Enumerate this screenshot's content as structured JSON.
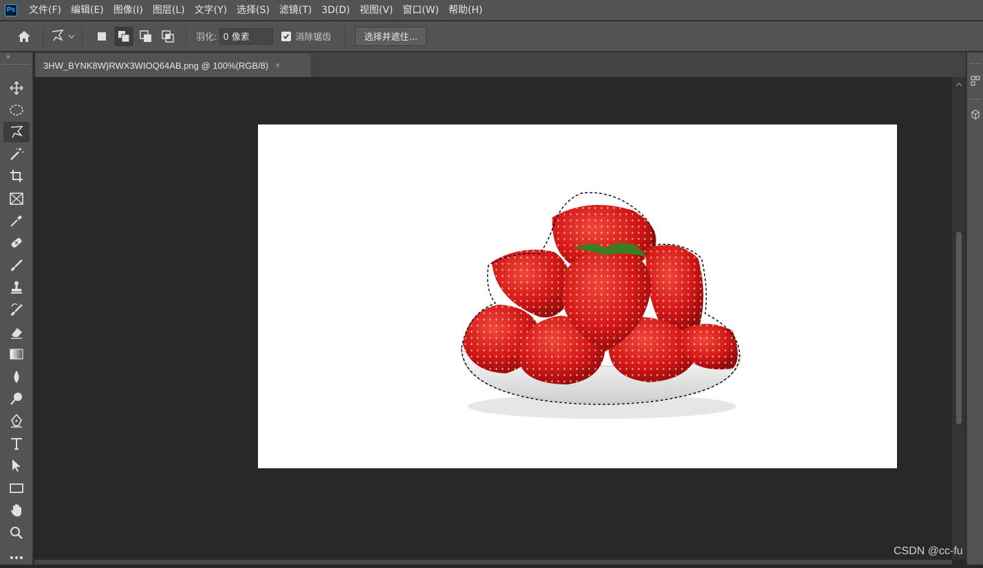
{
  "app": {
    "logo_text": "Ps",
    "accent": "#31a8ff"
  },
  "menu": [
    "文件(F)",
    "编辑(E)",
    "图像(I)",
    "图层(L)",
    "文字(Y)",
    "选择(S)",
    "滤镜(T)",
    "3D(D)",
    "视图(V)",
    "窗口(W)",
    "帮助(H)"
  ],
  "options": {
    "home_icon": "home-icon",
    "tool_preset_icon": "polygonal-lasso-icon",
    "feather_label": "羽化:",
    "feather_value": "0 像素",
    "antialias_label": "消除锯齿",
    "antialias_checked": true,
    "select_mask_label": "选择并遮住..."
  },
  "tools": [
    "move-icon",
    "ellipse-marquee-icon",
    "polygonal-lasso-icon",
    "magic-wand-icon",
    "crop-icon",
    "frame-icon",
    "eyedropper-icon",
    "healing-brush-icon",
    "brush-icon",
    "clone-stamp-icon",
    "history-brush-icon",
    "eraser-icon",
    "gradient-icon",
    "blur-icon",
    "dodge-icon",
    "pen-icon",
    "type-icon",
    "path-selection-icon",
    "rectangle-icon",
    "hand-icon",
    "zoom-icon",
    "more-tools-icon"
  ],
  "active_tool": "polygonal-lasso-icon",
  "document": {
    "tab_title": "3HW_BYNK8W}RWX3WIOQ64AB.png @ 100%(RGB/8)",
    "close_symbol": "×"
  },
  "watermark": "CSDN @cc-fu"
}
